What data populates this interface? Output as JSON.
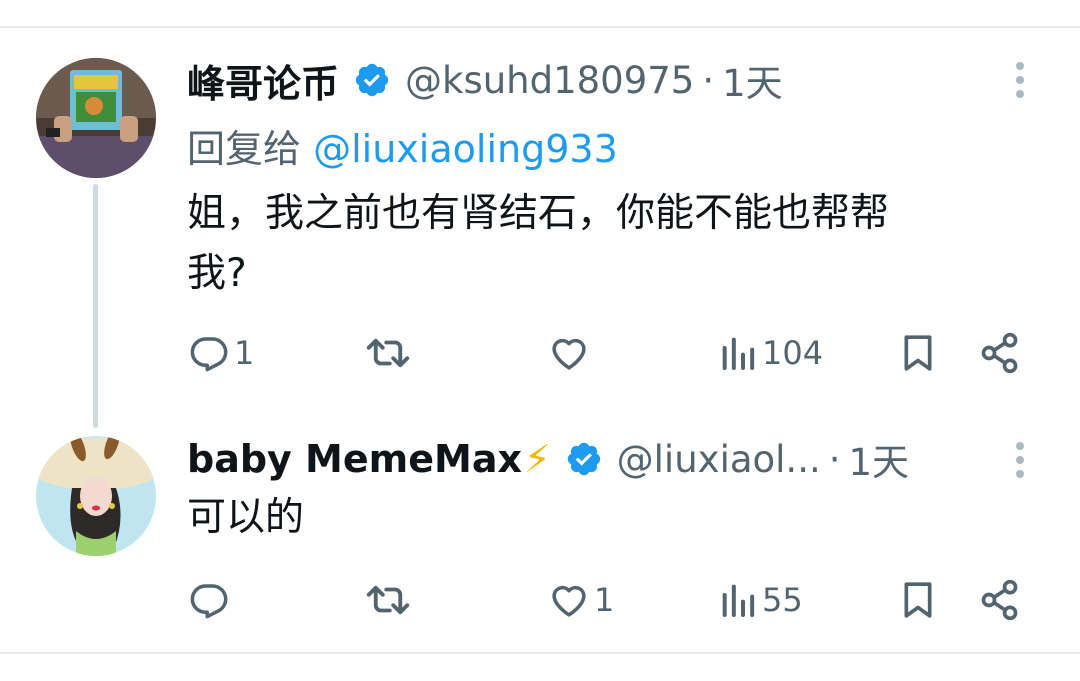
{
  "tweets": [
    {
      "author": "峰哥论币",
      "handle": "@ksuhd180975",
      "dot": "·",
      "time": "1天",
      "reply_prefix": "回复给",
      "reply_mention": "@liuxiaoling933",
      "text_line1": "姐，我之前也有肾结石，你能不能也帮帮",
      "text_line2": "我?",
      "reply_count": "1",
      "retweet_count": "",
      "like_count": "",
      "views_count": "104"
    },
    {
      "author": "baby MemeMax",
      "author_emoji": "⚡",
      "handle": "@liuxiaol...",
      "dot": "·",
      "time": "1天",
      "text": "可以的",
      "reply_count": "",
      "retweet_count": "",
      "like_count": "1",
      "views_count": "55"
    }
  ],
  "icons": {
    "verified": "verified-badge-icon",
    "more": "more-vertical-icon",
    "reply": "reply-icon",
    "retweet": "retweet-icon",
    "like": "heart-icon",
    "views": "views-icon",
    "bookmark": "bookmark-icon",
    "share": "share-icon"
  },
  "colors": {
    "text": "#0f1419",
    "secondary": "#536471",
    "link": "#1d9bf0",
    "verified": "#1d9bf0",
    "divider": "#e7e9ea",
    "thread_line": "#cfd9de"
  }
}
